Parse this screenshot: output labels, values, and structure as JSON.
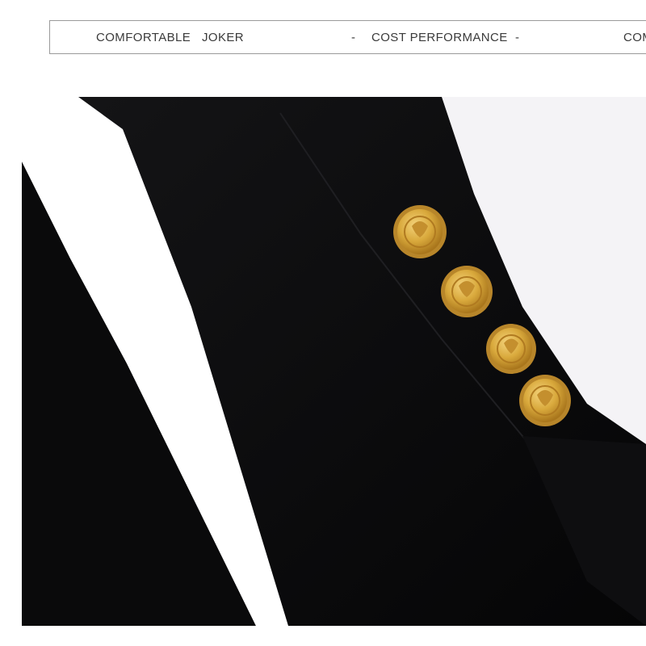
{
  "banner": {
    "items": [
      {
        "text": "COMFORTABLE"
      },
      {
        "text": "JOKER"
      },
      {
        "text": "-"
      },
      {
        "text": "COST PERFORMANCE"
      },
      {
        "text": "-"
      },
      {
        "text": "COM"
      }
    ]
  },
  "photo": {
    "subject": "black blazer sleeve with four gold crest buttons",
    "colors": {
      "background": "#f4f3f6",
      "fabric": "#0b0b0d",
      "lining": "#ffffff",
      "button_gold": "#d9a93c"
    },
    "button_count": 4
  }
}
